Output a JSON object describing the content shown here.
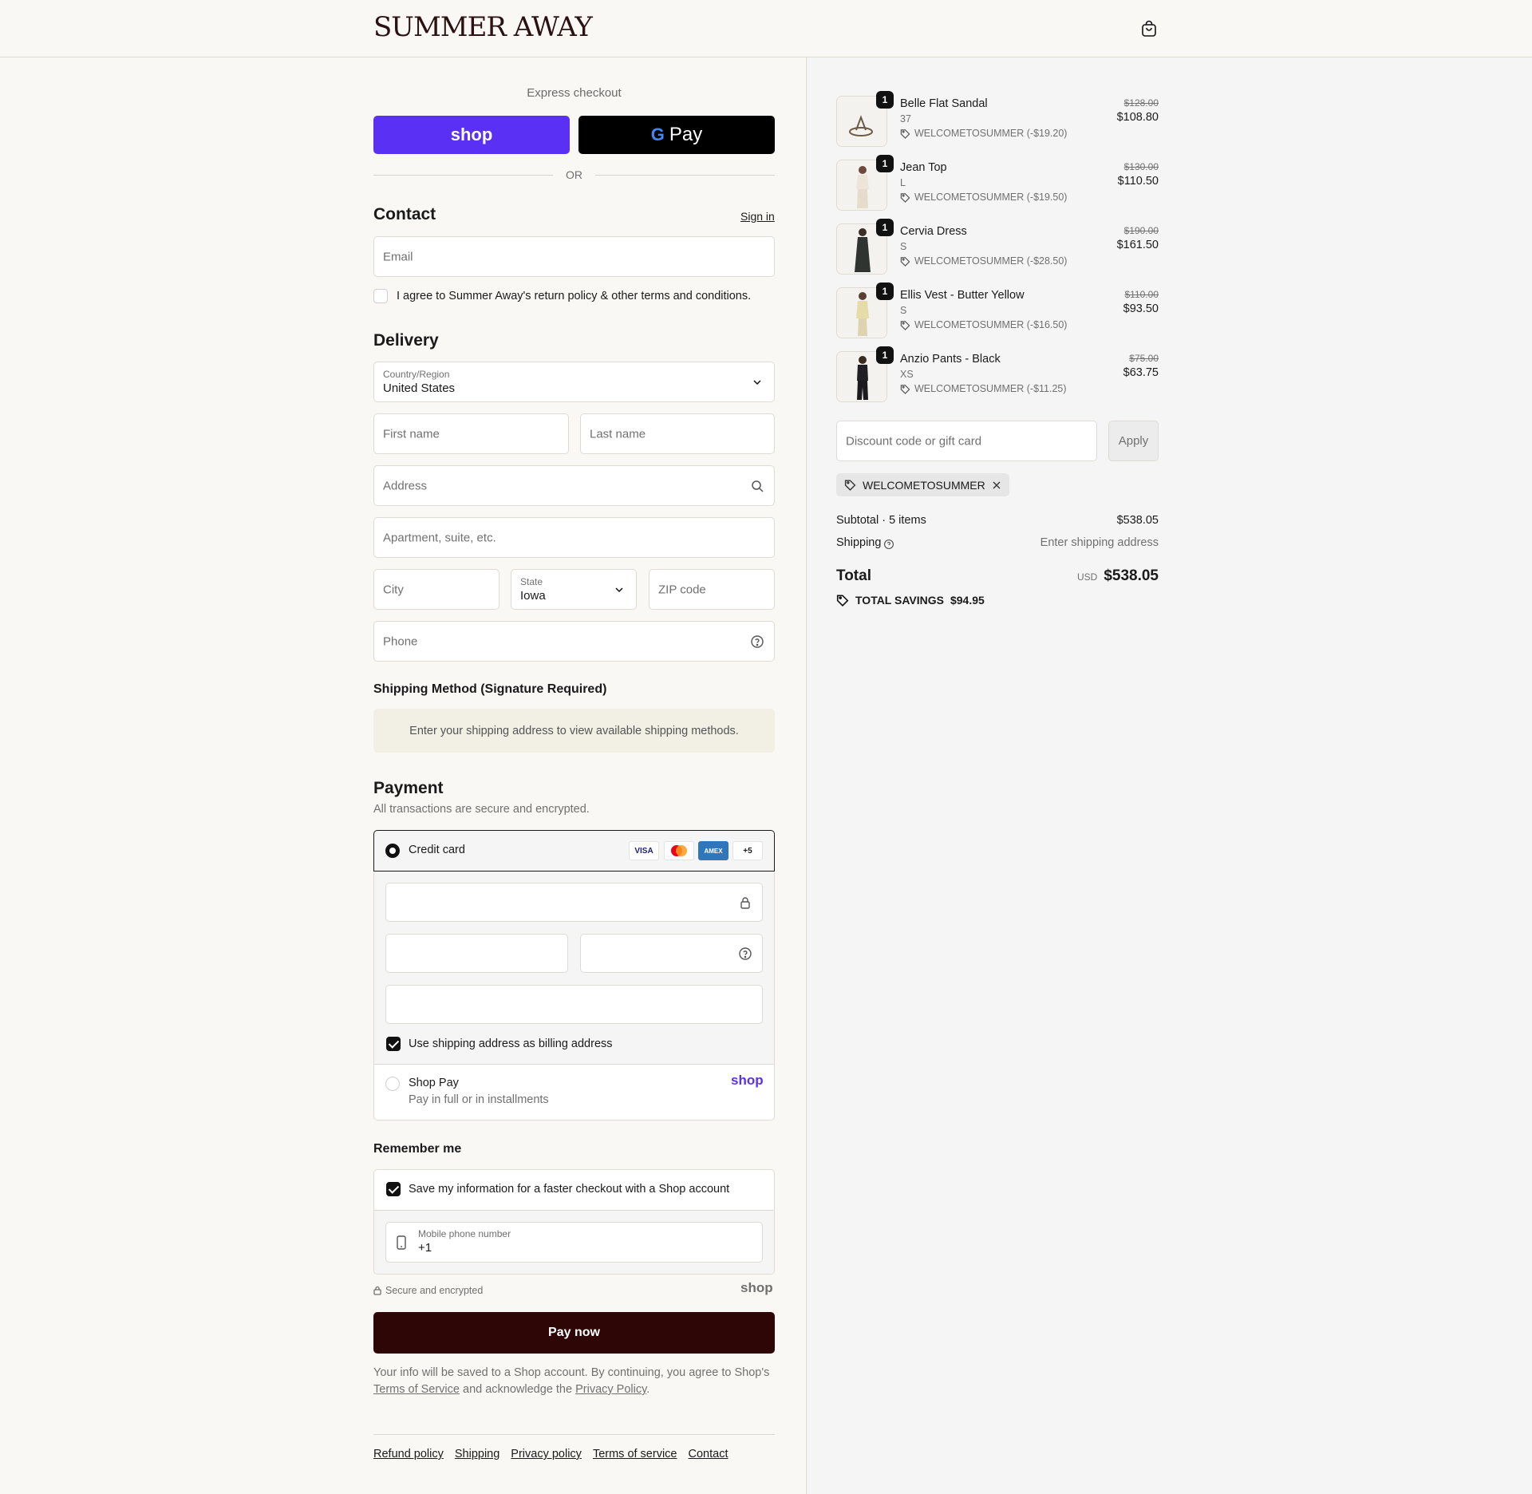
{
  "header": {
    "logo": "SUMMER AWAY",
    "cart_icon": "shopping-bag-icon"
  },
  "express": {
    "title": "Express checkout",
    "shop_label": "shop",
    "gpay_label": "Pay",
    "or_label": "OR"
  },
  "contact": {
    "title": "Contact",
    "sign_in": "Sign in",
    "email_placeholder": "Email",
    "terms_label": "I agree to Summer Away's return policy & other terms and conditions."
  },
  "delivery": {
    "title": "Delivery",
    "country_label": "Country/Region",
    "country_value": "United States",
    "first_name": "First name",
    "last_name": "Last name",
    "address": "Address",
    "apartment": "Apartment, suite, etc.",
    "city": "City",
    "state_label": "State",
    "state_value": "Iowa",
    "zip": "ZIP code",
    "phone": "Phone"
  },
  "shipping_method": {
    "title": "Shipping Method (Signature Required)",
    "note": "Enter your shipping address to view available shipping methods."
  },
  "payment": {
    "title": "Payment",
    "subtitle": "All transactions are secure and encrypted.",
    "credit_card_label": "Credit card",
    "cards": [
      "VISA",
      "MC",
      "AMEX",
      "+5"
    ],
    "billing_label": "Use shipping address as billing address",
    "shop_pay_label": "Shop Pay",
    "shop_pay_sub": "Pay in full or in installments",
    "shop_pay_logo": "shop"
  },
  "remember": {
    "title": "Remember me",
    "save_label": "Save my information for a faster checkout with a Shop account",
    "mobile_label": "Mobile phone number",
    "mobile_value": "+1",
    "secure_label": "Secure and encrypted",
    "shop_logo": "shop"
  },
  "pay_now": "Pay now",
  "legal": {
    "prefix": "Your info will be saved to a Shop account. By continuing, you agree to Shop's",
    "tos": "Terms of Service",
    "middle": "and acknowledge the",
    "privacy": "Privacy Policy",
    "suffix": "."
  },
  "footer": [
    "Refund policy",
    "Shipping",
    "Privacy policy",
    "Terms of service",
    "Contact"
  ],
  "items": [
    {
      "name": "Belle Flat Sandal",
      "variant": "37",
      "discount": "WELCOMETOSUMMER (-$19.20)",
      "old_price": "$128.00",
      "price": "$108.80",
      "qty": "1"
    },
    {
      "name": "Jean Top",
      "variant": "L",
      "discount": "WELCOMETOSUMMER (-$19.50)",
      "old_price": "$130.00",
      "price": "$110.50",
      "qty": "1"
    },
    {
      "name": "Cervia Dress",
      "variant": "S",
      "discount": "WELCOMETOSUMMER (-$28.50)",
      "old_price": "$190.00",
      "price": "$161.50",
      "qty": "1"
    },
    {
      "name": "Ellis Vest - Butter Yellow",
      "variant": "S",
      "discount": "WELCOMETOSUMMER (-$16.50)",
      "old_price": "$110.00",
      "price": "$93.50",
      "qty": "1"
    },
    {
      "name": "Anzio Pants - Black",
      "variant": "XS",
      "discount": "WELCOMETOSUMMER (-$11.25)",
      "old_price": "$75.00",
      "price": "$63.75",
      "qty": "1"
    }
  ],
  "discount": {
    "placeholder": "Discount code or gift card",
    "apply": "Apply",
    "applied_code": "WELCOMETOSUMMER"
  },
  "summary": {
    "subtotal_label": "Subtotal · 5 items",
    "subtotal_value": "$538.05",
    "shipping_label": "Shipping",
    "shipping_value": "Enter shipping address",
    "total_label": "Total",
    "currency": "USD",
    "total_value": "$538.05",
    "savings_label": "TOTAL SAVINGS",
    "savings_value": "$94.95"
  },
  "colors": {
    "shop_purple": "#5a31f4",
    "pay_now": "#2f0606",
    "logo": "#2b1212"
  }
}
